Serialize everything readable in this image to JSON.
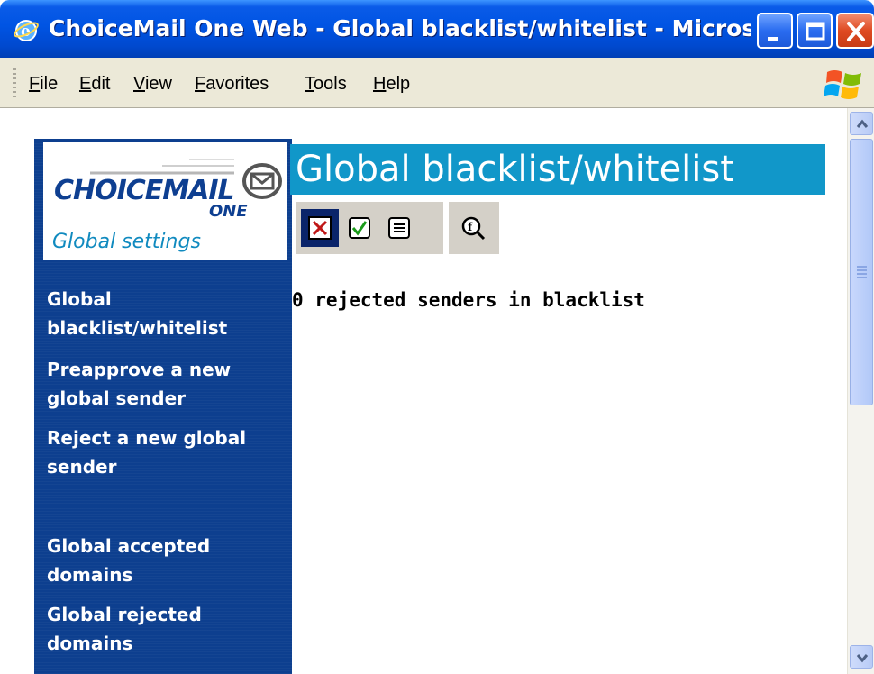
{
  "window": {
    "title": "ChoiceMail One Web - Global blacklist/whitelist - Microsoft I..."
  },
  "menu": {
    "items": [
      "File",
      "Edit",
      "View",
      "Favorites",
      "Tools",
      "Help"
    ]
  },
  "sidebar": {
    "logo_word": "CHOICEMAIL",
    "logo_one": "ONE",
    "logo_caption": "Global settings",
    "links": [
      "Global blacklist/whitelist",
      "Preapprove a new global sender",
      "Reject a new global sender",
      "Global accepted domains",
      "Global rejected domains"
    ]
  },
  "main": {
    "title": "Global blacklist/whitelist",
    "status": "0 rejected senders in blacklist",
    "toolbar_icons": [
      "reject-icon",
      "approve-icon",
      "list-icon",
      "search-icon"
    ]
  },
  "colors": {
    "title_bar": "#0054e3",
    "sidebar_bg": "#0d3f8f",
    "header_bg": "#1197c9",
    "toolbar_bg": "#d4d0c8"
  }
}
